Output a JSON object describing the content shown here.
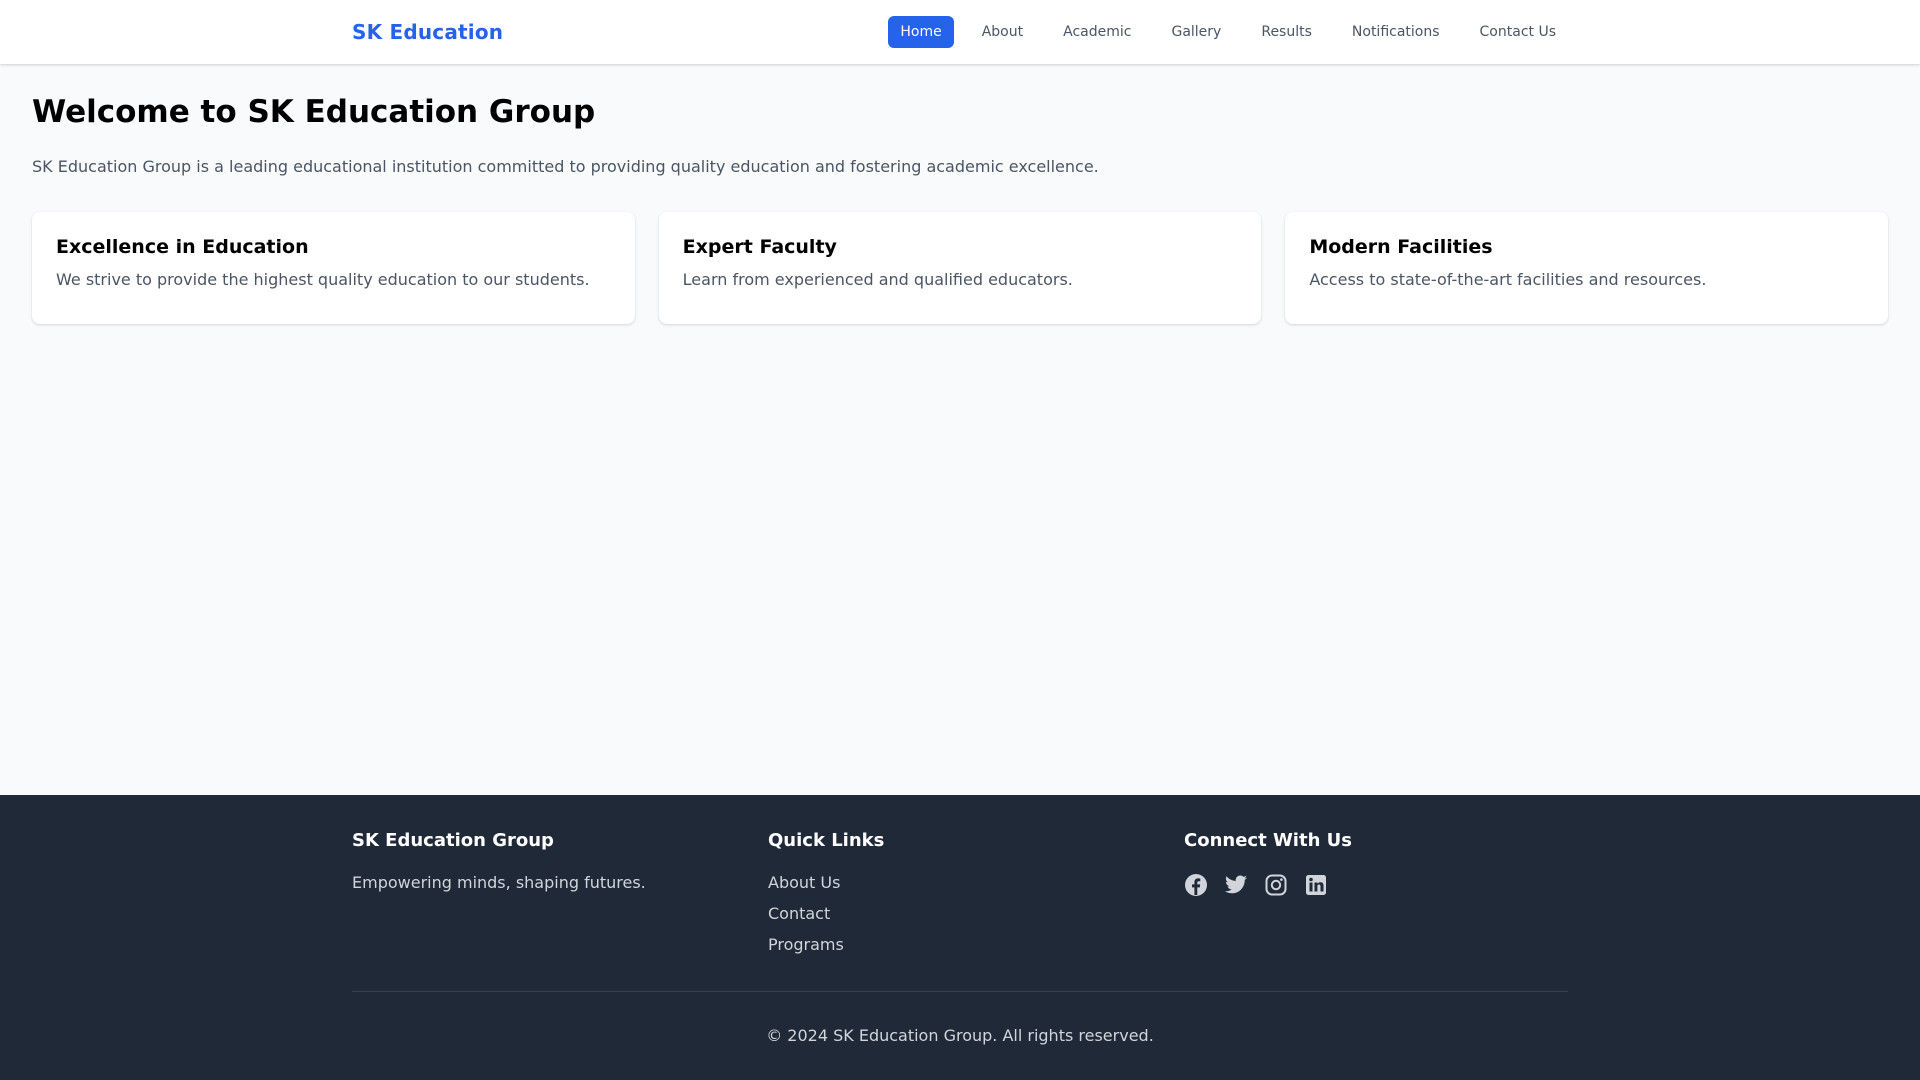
{
  "navbar": {
    "brand": "SK Education",
    "items": [
      {
        "label": "Home",
        "active": true
      },
      {
        "label": "About"
      },
      {
        "label": "Academic"
      },
      {
        "label": "Gallery"
      },
      {
        "label": "Results"
      },
      {
        "label": "Notifications"
      },
      {
        "label": "Contact Us"
      }
    ]
  },
  "main": {
    "title": "Welcome to SK Education Group",
    "intro": "SK Education Group is a leading educational institution committed to providing quality education and fostering academic excellence.",
    "cards": [
      {
        "title": "Excellence in Education",
        "text": "We strive to provide the highest quality education to our students."
      },
      {
        "title": "Expert Faculty",
        "text": "Learn from experienced and qualified educators."
      },
      {
        "title": "Modern Facilities",
        "text": "Access to state-of-the-art facilities and resources."
      }
    ]
  },
  "footer": {
    "about": {
      "title": "SK Education Group",
      "text": "Empowering minds, shaping futures."
    },
    "links": {
      "title": "Quick Links",
      "items": [
        "About Us",
        "Contact",
        "Programs"
      ]
    },
    "connect": {
      "title": "Connect With Us",
      "icons": [
        "facebook-icon",
        "twitter-icon",
        "instagram-icon",
        "linkedin-icon"
      ]
    },
    "copyright": "© 2024 SK Education Group. All rights reserved."
  },
  "colors": {
    "accent": "#2563eb",
    "footer_bg": "#1f2937",
    "page_bg": "#f8fafc",
    "muted_text": "#4b5563"
  }
}
